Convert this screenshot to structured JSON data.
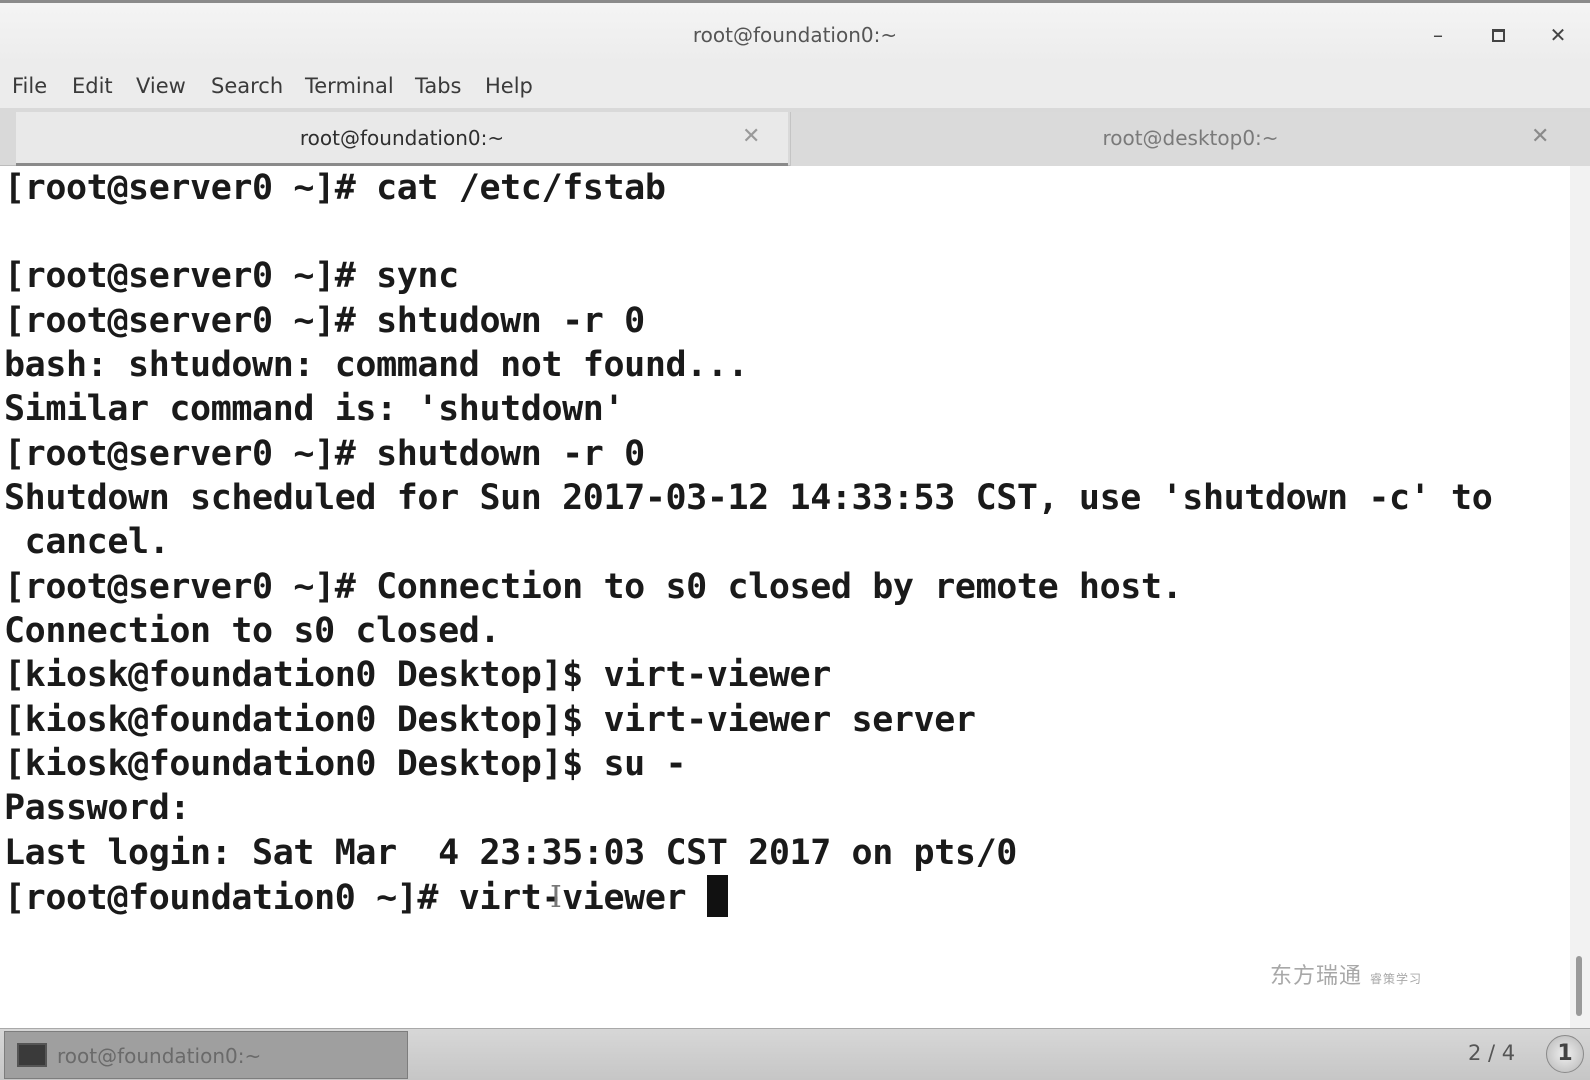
{
  "window": {
    "title": "root@foundation0:~",
    "minimize_label": "–",
    "close_label": "✕"
  },
  "menu": {
    "items": [
      "File",
      "Edit",
      "View",
      "Search",
      "Terminal",
      "Tabs",
      "Help"
    ]
  },
  "tabs": [
    {
      "label": "root@foundation0:~",
      "close": "✕",
      "active": true
    },
    {
      "label": "root@desktop0:~",
      "close": "✕",
      "active": false
    }
  ],
  "terminal": {
    "lines": [
      "[root@server0 ~]# cat /etc/fstab",
      "",
      "[root@server0 ~]# sync",
      "[root@server0 ~]# shtudown -r 0",
      "bash: shtudown: command not found...",
      "Similar command is: 'shutdown'",
      "[root@server0 ~]# shutdown -r 0",
      "Shutdown scheduled for Sun 2017-03-12 14:33:53 CST, use 'shutdown -c' to",
      " cancel.",
      "[root@server0 ~]# Connection to s0 closed by remote host.",
      "Connection to s0 closed.",
      "[kiosk@foundation0 Desktop]$ virt-viewer",
      "[kiosk@foundation0 Desktop]$ virt-viewer server",
      "[kiosk@foundation0 Desktop]$ su -",
      "Password:",
      "Last login: Sat Mar  4 23:35:03 CST 2017 on pts/0",
      "[root@foundation0 ~]# virt-viewer "
    ]
  },
  "watermark": {
    "text": "东方瑞通",
    "sub": "睿策学习"
  },
  "taskbar": {
    "window_label": "root@foundation0:~",
    "workspace": "2 / 4",
    "notification": "1"
  }
}
